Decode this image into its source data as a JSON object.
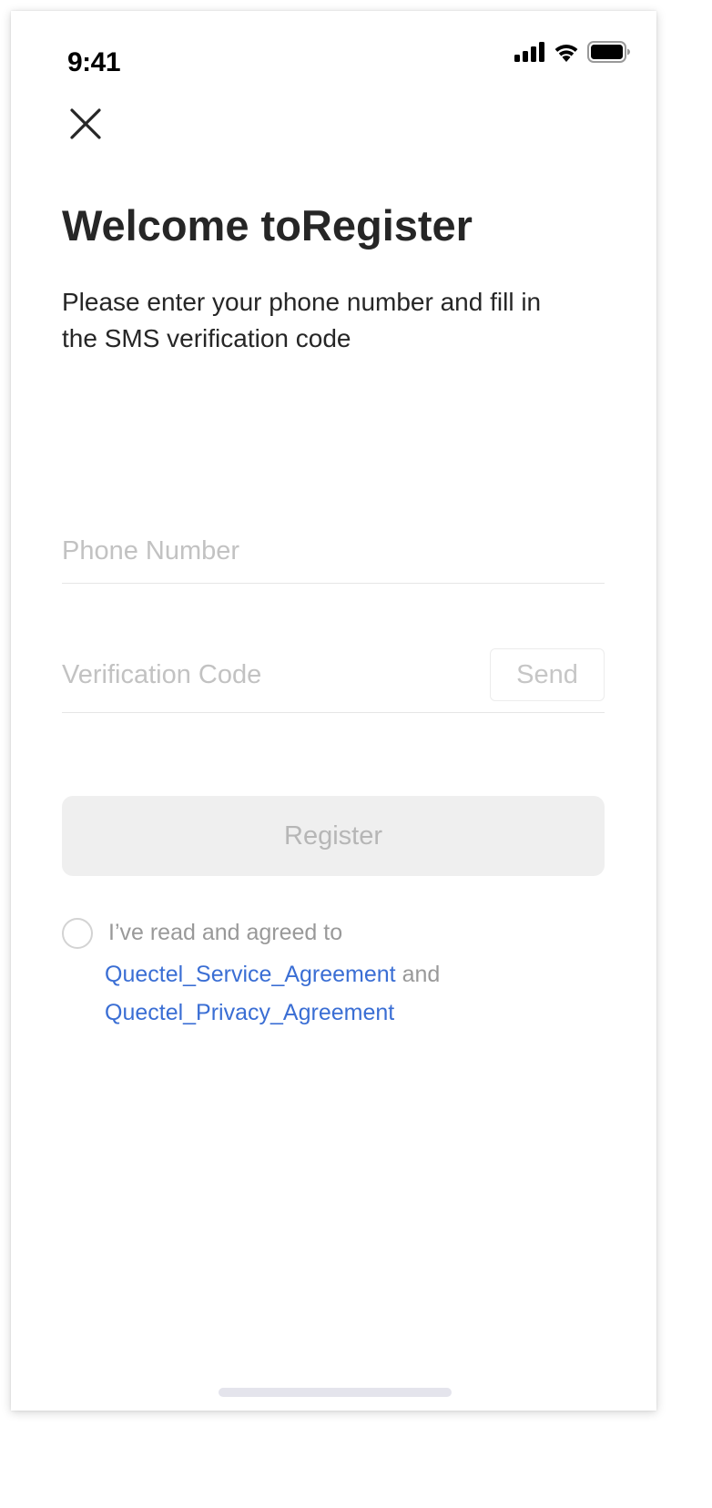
{
  "status_bar": {
    "time": "9:41",
    "icons": [
      "signal-icon",
      "wifi-icon",
      "battery-icon"
    ]
  },
  "header": {
    "close_icon": "close-icon"
  },
  "main": {
    "title": "Welcome toRegister",
    "subtitle": "Please enter your phone number and fill in the SMS verification code"
  },
  "form": {
    "phone_placeholder": "Phone Number",
    "phone_value": "",
    "code_placeholder": "Verification Code",
    "code_value": "",
    "send_label": "Send",
    "register_label": "Register"
  },
  "agreement": {
    "checked": false,
    "prefix": "I’ve read and agreed to",
    "service_link": "Quectel_Service_Agreement",
    "conjunction": " and",
    "privacy_link": "Quectel_Privacy_Agreement"
  },
  "colors": {
    "title_text": "#262626",
    "placeholder": "#c2c2c2",
    "link": "#3a6ed4",
    "register_bg_disabled": "#efefef",
    "register_text_disabled": "#b6b6b6",
    "muted_text": "#999999"
  }
}
